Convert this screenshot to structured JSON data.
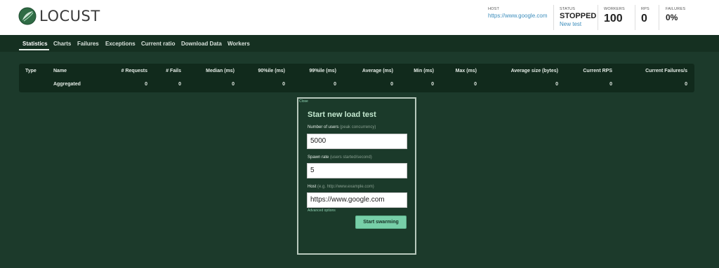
{
  "app": {
    "title": "LOCUST"
  },
  "header": {
    "host": {
      "label": "HOST",
      "value": "https://www.google.com"
    },
    "status": {
      "label": "STATUS",
      "value": "STOPPED",
      "link": "New test"
    },
    "workers": {
      "label": "WORKERS",
      "value": "100"
    },
    "rps": {
      "label": "RPS",
      "value": "0"
    },
    "failures": {
      "label": "FAILURES",
      "value": "0%"
    }
  },
  "nav": {
    "tabs": [
      {
        "label": "Statistics",
        "active": true
      },
      {
        "label": "Charts"
      },
      {
        "label": "Failures"
      },
      {
        "label": "Exceptions"
      },
      {
        "label": "Current ratio"
      },
      {
        "label": "Download Data"
      },
      {
        "label": "Workers"
      }
    ]
  },
  "table": {
    "columns": [
      "Type",
      "Name",
      "# Requests",
      "# Fails",
      "Median (ms)",
      "90%ile (ms)",
      "99%ile (ms)",
      "Average (ms)",
      "Min (ms)",
      "Max (ms)",
      "Average size (bytes)",
      "Current RPS",
      "Current Failures/s"
    ],
    "rows": [
      {
        "type": "",
        "name": "Aggregated",
        "requests": "0",
        "fails": "0",
        "median": "0",
        "p90": "0",
        "p99": "0",
        "average": "0",
        "min": "0",
        "max": "0",
        "avg_size": "0",
        "current_rps": "0",
        "current_failures": "0"
      }
    ]
  },
  "modal": {
    "close_label": "Close",
    "title": "Start new load test",
    "users": {
      "label": "Number of users",
      "hint": "(peak concurrency)",
      "value": "5000"
    },
    "spawn_rate": {
      "label": "Spawn rate",
      "hint": "(users started/second)",
      "value": "5"
    },
    "host": {
      "label": "Host",
      "hint": "(e.g. http://www.example.com)",
      "value": "https://www.google.com"
    },
    "advanced_label": "Advanced options",
    "submit_label": "Start swarming"
  },
  "colors": {
    "accent": "#77cfa8",
    "background": "#1c3a2b",
    "link": "#3c8dbc"
  },
  "icons": {
    "logo": "locust-logo-icon"
  }
}
